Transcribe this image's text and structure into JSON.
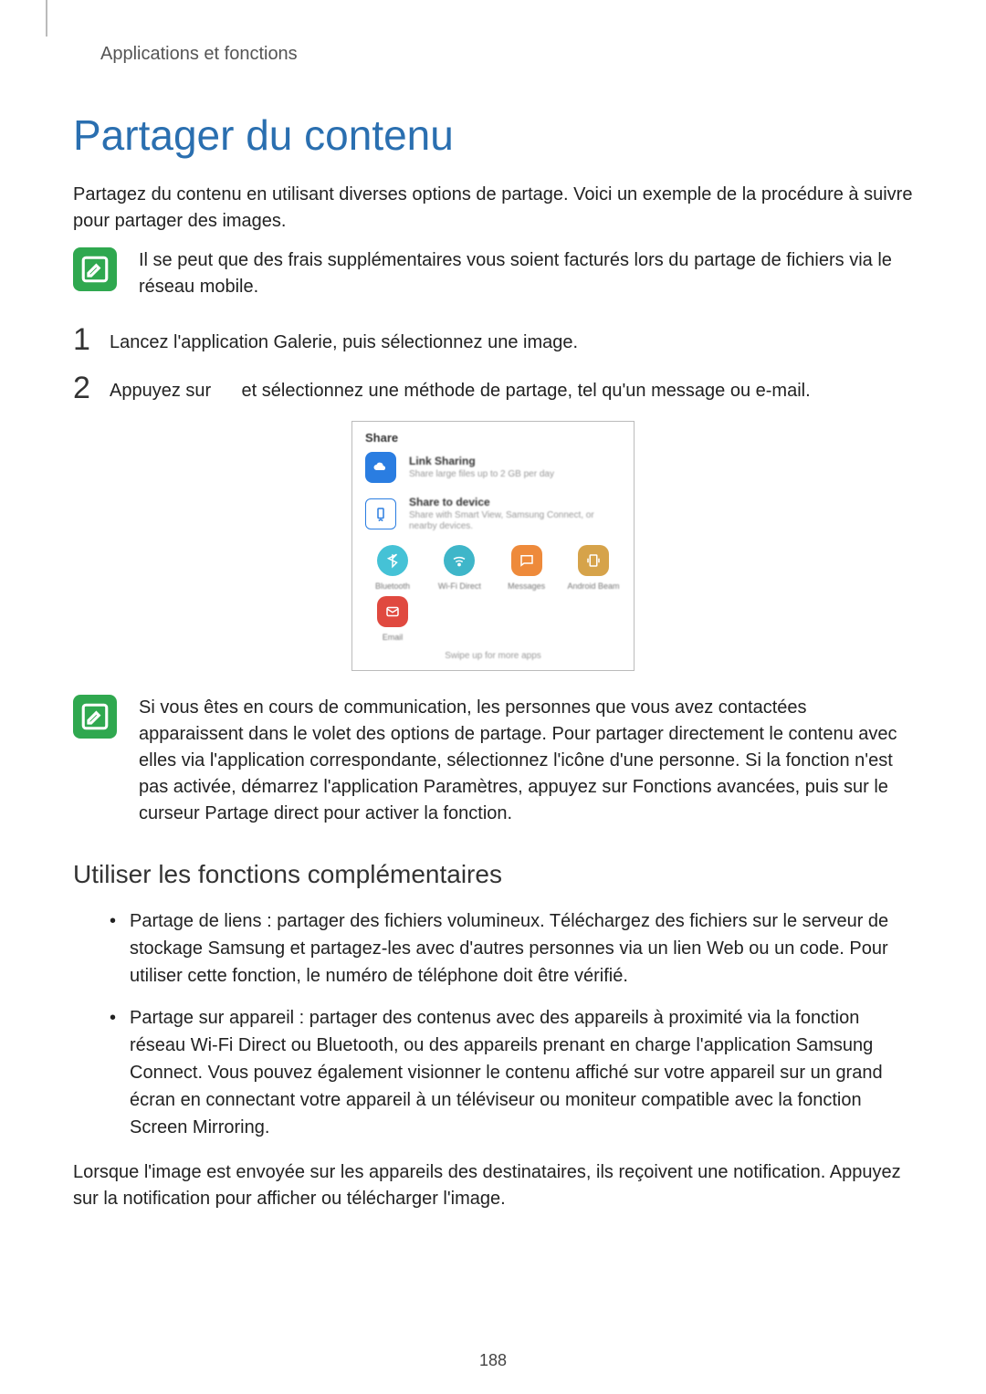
{
  "breadcrumb": "Applications et fonctions",
  "title": "Partager du contenu",
  "intro": "Partagez du contenu en utilisant diverses options de partage. Voici un exemple de la procédure à suivre pour partager des images.",
  "note1": "Il se peut que des frais supplémentaires vous soient facturés lors du partage de fichiers via le réseau mobile.",
  "step1_pre": "Lancez l'application ",
  "step1_app": "Galerie",
  "step1_post": ", puis sélectionnez une image.",
  "step2_pre": "Appuyez sur ",
  "step2_post": " et sélectionnez une méthode de partage, tel qu'un message ou e-mail.",
  "figure": {
    "title": "Share",
    "link_sharing": "Link Sharing",
    "link_sharing_sub": "Share large files up to 2 GB per day",
    "share_to_device": "Share to device",
    "share_to_device_sub": "Share with Smart View, Samsung Connect, or nearby devices.",
    "cells": [
      "Bluetooth",
      "Wi-Fi Direct",
      "Messages",
      "Android Beam",
      "Email"
    ],
    "footer": "Swipe up for more apps"
  },
  "note2_a": "Si vous êtes en cours de communication, les personnes que vous avez contactées apparaissent dans le volet des options de partage. Pour partager directement le contenu avec elles via l'application correspondante, sélectionnez l'icône d'une personne. Si la fonction n'est pas activée, démarrez l'application ",
  "note2_b": "Paramètres",
  "note2_c": ", appuyez sur ",
  "note2_d": "Fonctions avancées",
  "note2_e": ", puis sur le curseur ",
  "note2_f": "Partage direct",
  "note2_g": " pour activer la fonction.",
  "h2": "Utiliser les fonctions complémentaires",
  "bullet1_lead": "Partage de liens",
  "bullet1_body": " : partager des fichiers volumineux. Téléchargez des fichiers sur le serveur de stockage Samsung et partagez-les avec d'autres personnes via un lien Web ou un code. Pour utiliser cette fonction, le numéro de téléphone doit être vérifié.",
  "bullet2_lead": "Partage sur appareil",
  "bullet2_body": " : partager des contenus avec des appareils à proximité via la fonction réseau Wi-Fi Direct ou Bluetooth, ou des appareils prenant en charge l'application Samsung Connect. Vous pouvez également visionner le contenu affiché sur votre appareil sur un grand écran en connectant votre appareil à un téléviseur ou moniteur compatible avec la fonction Screen Mirroring.",
  "closing": "Lorsque l'image est envoyée sur les appareils des destinataires, ils reçoivent une notification. Appuyez sur la notification pour afficher ou télécharger l'image.",
  "page_number": "188"
}
